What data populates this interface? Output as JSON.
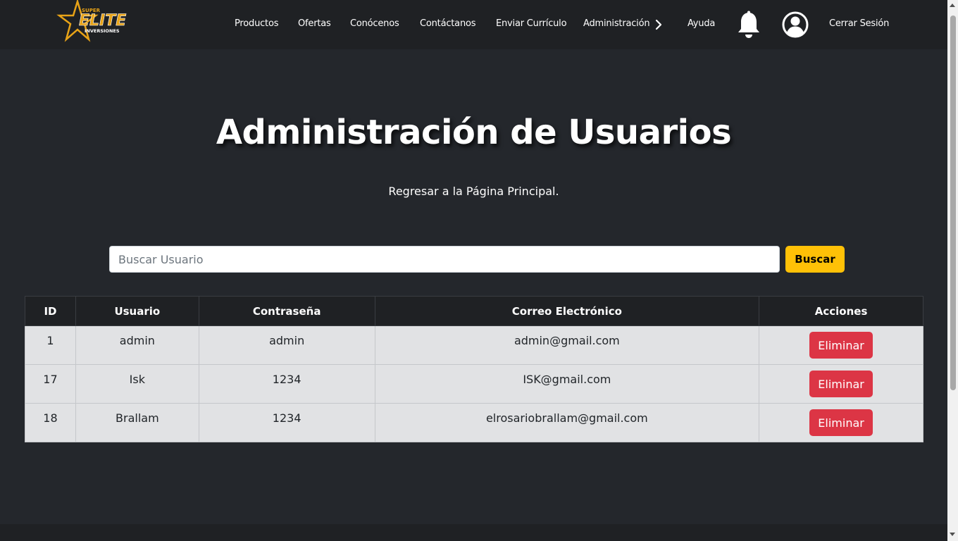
{
  "nav": {
    "logo_text_top": "SUPER",
    "logo_text_main": "ELITE",
    "logo_text_bottom": "INVERSIONES",
    "items": [
      {
        "label": "Productos"
      },
      {
        "label": "Ofertas"
      },
      {
        "label": "Conócenos"
      },
      {
        "label": "Contáctanos"
      },
      {
        "label": "Enviar Currículo"
      },
      {
        "label": "Administración"
      },
      {
        "label": "Ayuda"
      }
    ],
    "logout_label": "Cerrar Sesión",
    "icons": [
      "chevron-right-icon",
      "bell-icon",
      "user-icon"
    ],
    "background_color": "#1f2124"
  },
  "main": {
    "title": "Administración de Usuarios",
    "back_link": "Regresar a la Página Principal.",
    "search": {
      "placeholder": "Buscar Usuario",
      "value": "",
      "button_label": "Buscar",
      "button_color": "#ffc107"
    },
    "table": {
      "headers": [
        "ID",
        "Usuario",
        "Contraseña",
        "Correo Electrónico",
        "Acciones"
      ],
      "rows": [
        {
          "id": "1",
          "usuario": "admin",
          "contrasena": "admin",
          "correo": "admin@gmail.com",
          "accion": "Eliminar"
        },
        {
          "id": "17",
          "usuario": "Isk",
          "contrasena": "1234",
          "correo": "ISK@gmail.com",
          "accion": "Eliminar"
        },
        {
          "id": "18",
          "usuario": "Brallam",
          "contrasena": "1234",
          "correo": "elrosariobrallam@gmail.com",
          "accion": "Eliminar"
        }
      ],
      "delete_button_color": "#dc3545"
    }
  },
  "colors": {
    "page_background": "#24272c",
    "accent": "#ffc107",
    "danger": "#dc3545"
  }
}
